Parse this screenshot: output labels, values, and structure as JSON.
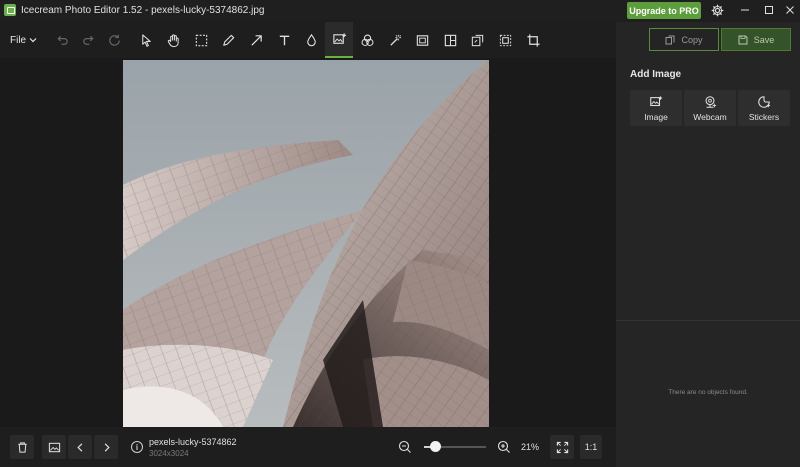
{
  "window": {
    "title": "Icecream Photo Editor 1.52 - pexels-lucky-5374862.jpg",
    "upgrade_label": "Upgrade to PRO"
  },
  "toolbar": {
    "file_label": "File",
    "tools": [
      {
        "name": "undo",
        "icon": "undo-icon"
      },
      {
        "name": "redo",
        "icon": "redo-icon"
      },
      {
        "name": "reset",
        "icon": "reset-icon"
      },
      {
        "name": "select",
        "icon": "cursor-icon"
      },
      {
        "name": "pan",
        "icon": "hand-icon"
      },
      {
        "name": "marquee",
        "icon": "marquee-icon"
      },
      {
        "name": "pencil",
        "icon": "pencil-icon"
      },
      {
        "name": "arrow",
        "icon": "arrow-icon"
      },
      {
        "name": "text",
        "icon": "text-icon"
      },
      {
        "name": "blur",
        "icon": "drop-icon"
      },
      {
        "name": "add-image",
        "icon": "add-image-icon"
      },
      {
        "name": "filters",
        "icon": "filters-icon"
      },
      {
        "name": "magic",
        "icon": "magic-wand-icon"
      },
      {
        "name": "frame",
        "icon": "frame-icon"
      },
      {
        "name": "collage",
        "icon": "collage-icon"
      },
      {
        "name": "export",
        "icon": "export-icon"
      },
      {
        "name": "resize",
        "icon": "resize-icon"
      },
      {
        "name": "crop",
        "icon": "crop-icon"
      }
    ],
    "active_tool": "add-image"
  },
  "right_panel": {
    "copy_label": "Copy",
    "save_label": "Save",
    "section_title": "Add Image",
    "tiles": [
      {
        "label": "Image",
        "icon": "image-icon"
      },
      {
        "label": "Webcam",
        "icon": "webcam-icon"
      },
      {
        "label": "Stickers",
        "icon": "sticker-icon"
      }
    ],
    "empty_message": "There are no objects found."
  },
  "bottom": {
    "file_name": "pexels-lucky-5374862",
    "file_dims": "3024x3024",
    "zoom_pct": "21%",
    "zoom_level": 0.18,
    "one_to_one": "1:1"
  },
  "colors": {
    "accent": "#5d9e3c",
    "active_underline": "#69b33f"
  }
}
